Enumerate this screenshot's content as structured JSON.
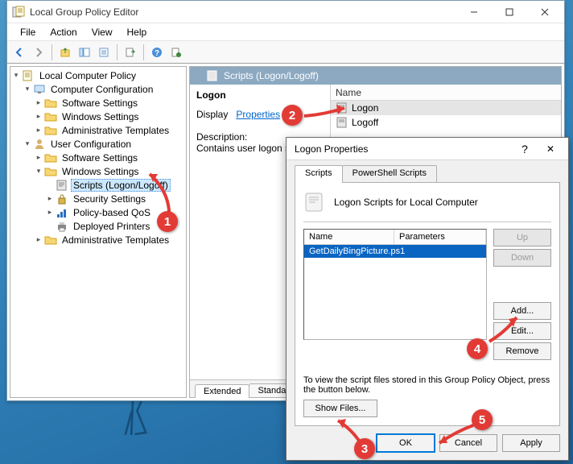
{
  "gpe": {
    "title": "Local Group Policy Editor",
    "menus": [
      "File",
      "Action",
      "View",
      "Help"
    ],
    "tree": {
      "root": "Local Computer Policy",
      "comp": "Computer Configuration",
      "comp_sw": "Software Settings",
      "comp_win": "Windows Settings",
      "comp_admin": "Administrative Templates",
      "user": "User Configuration",
      "user_sw": "Software Settings",
      "user_win": "Windows Settings",
      "scripts": "Scripts (Logon/Logoff)",
      "security": "Security Settings",
      "qos": "Policy-based QoS",
      "printers": "Deployed Printers",
      "user_admin": "Administrative Templates"
    },
    "content": {
      "header": "Scripts (Logon/Logoff)",
      "heading": "Logon",
      "display_label": "Display",
      "display_link": "Properties",
      "desc_label": "Description:",
      "desc_text": "Contains user logon scripts.",
      "col_name": "Name",
      "rows": [
        "Logon",
        "Logoff"
      ]
    },
    "ext_tabs": [
      "Extended",
      "Standard"
    ]
  },
  "props": {
    "title": "Logon Properties",
    "tabs": [
      "Scripts",
      "PowerShell Scripts"
    ],
    "panel_title": "Logon Scripts for Local Computer",
    "cols": {
      "name": "Name",
      "param": "Parameters"
    },
    "rows": [
      {
        "name": "GetDailyBingPicture.ps1",
        "param": ""
      }
    ],
    "side_btns": {
      "up": "Up",
      "down": "Down",
      "add": "Add...",
      "edit": "Edit...",
      "remove": "Remove"
    },
    "hint": "To view the script files stored in this Group Policy Object, press the button below.",
    "show_files": "Show Files...",
    "ok": "OK",
    "cancel": "Cancel",
    "apply": "Apply"
  },
  "annotations": {
    "a1": "1",
    "a2": "2",
    "a3": "3",
    "a4": "4",
    "a5": "5"
  }
}
